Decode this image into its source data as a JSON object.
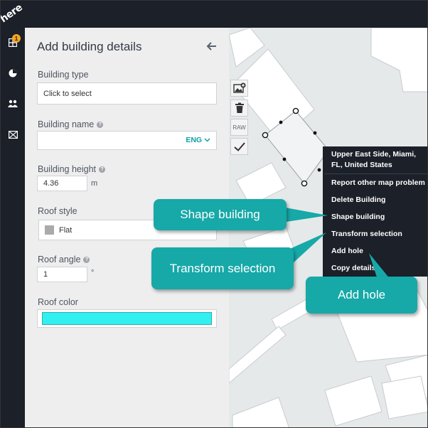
{
  "app": {
    "logo_text": "here",
    "notification_count": "1"
  },
  "panel": {
    "title": "Add building details",
    "building_type": {
      "label": "Building type",
      "value": "Click to select"
    },
    "building_name": {
      "label": "Building name",
      "value": "",
      "language": "ENG"
    },
    "building_height": {
      "label": "Building height",
      "value": "4.36",
      "unit": "m"
    },
    "roof_style": {
      "label": "Roof style",
      "value": "Flat"
    },
    "roof_angle": {
      "label": "Roof angle",
      "value": "1",
      "unit": "°"
    },
    "roof_color": {
      "label": "Roof color",
      "value": "#33f0f0"
    }
  },
  "toolbar": {
    "raw_label": "RAW"
  },
  "context_menu": {
    "location": "Upper East Side, Miami, FL, United States",
    "items": [
      "Report other map problem",
      "Delete Building",
      "Shape building",
      "Transform selection",
      "Add hole",
      "Copy details"
    ]
  },
  "callouts": {
    "shape_building": "Shape building",
    "transform_selection": "Transform selection",
    "add_hole": "Add hole"
  },
  "colors": {
    "accent": "#17a8a8",
    "dark": "#1b2029",
    "panel": "#eeeeee",
    "map": "#e6e9ea"
  }
}
